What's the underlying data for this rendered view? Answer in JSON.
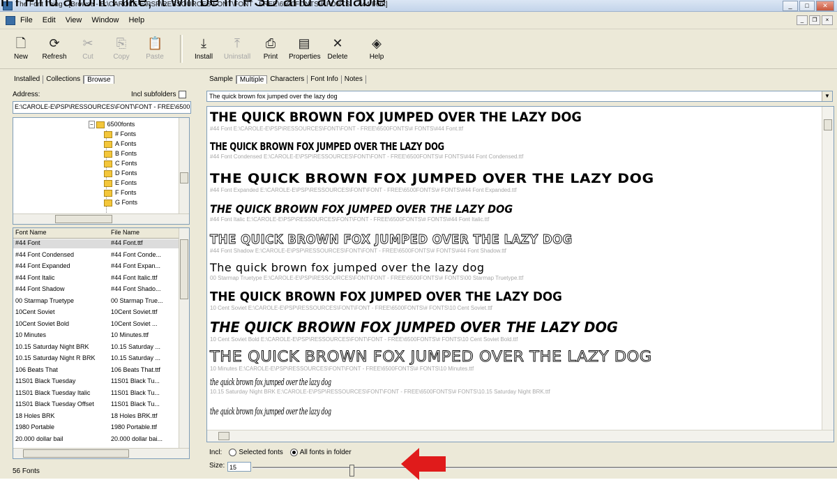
{
  "overlay_text": "If I Find a font I like, it will be in PSD and available",
  "window": {
    "title": "The Font Thing - [Browse - E:\\CAROLE-E\\PSP\\RESSOURCES\\FONT\\FONT - FREE\\6500FONTS\\# FONTS\\ - #44 Font]"
  },
  "menu": [
    "File",
    "Edit",
    "View",
    "Window",
    "Help"
  ],
  "toolbar": {
    "new": "New",
    "refresh": "Refresh",
    "cut": "Cut",
    "copy": "Copy",
    "paste": "Paste",
    "install": "Install",
    "uninstall": "Uninstall",
    "print": "Print",
    "properties": "Properties",
    "delete": "Delete",
    "help": "Help"
  },
  "left": {
    "tabs": [
      "Installed",
      "Collections",
      "Browse"
    ],
    "address_label": "Address:",
    "incl_subfolders": "Incl subfolders",
    "address_value": "E:\\CAROLE-E\\PSP\\RESSOURCES\\FONT\\FONT - FREE\\6500FONTS\\# FONTS",
    "tree": [
      "6500fonts",
      "# Fonts",
      "A Fonts",
      "B Fonts",
      "C Fonts",
      "D Fonts",
      "E Fonts",
      "F Fonts",
      "G Fonts"
    ],
    "columns": [
      "Font Name",
      "File Name"
    ],
    "fonts": [
      [
        "#44 Font",
        "#44 Font.ttf"
      ],
      [
        "#44 Font Condensed",
        "#44 Font Conde..."
      ],
      [
        "#44 Font Expanded",
        "#44 Font Expan..."
      ],
      [
        "#44 Font Italic",
        "#44 Font Italic.ttf"
      ],
      [
        "#44 Font Shadow",
        "#44 Font Shado..."
      ],
      [
        "00 Starmap Truetype",
        "00 Starmap True..."
      ],
      [
        "10Cent Soviet",
        "10Cent Soviet.ttf"
      ],
      [
        "10Cent Soviet Bold",
        "10Cent Soviet ..."
      ],
      [
        "10 Minutes",
        "10 Minutes.ttf"
      ],
      [
        "10.15 Saturday Night BRK",
        "10.15 Saturday ..."
      ],
      [
        "10.15 Saturday Night R BRK",
        "10.15 Saturday ..."
      ],
      [
        "106 Beats That",
        "106 Beats That.ttf"
      ],
      [
        "11S01 Black Tuesday",
        "11S01 Black Tu..."
      ],
      [
        "11S01 Black Tuesday Italic",
        "11S01 Black Tu..."
      ],
      [
        "11S01 Black Tuesday Offset",
        "11S01 Black Tu..."
      ],
      [
        "18 Holes BRK",
        "18 Holes BRK.ttf"
      ],
      [
        "1980 Portable",
        "1980 Portable.ttf"
      ],
      [
        "20.000 dollar bail",
        "20.000 dollar bai..."
      ]
    ],
    "status": "56 Fonts"
  },
  "right": {
    "tabs": [
      "Sample",
      "Multiple",
      "Characters",
      "Font Info",
      "Notes"
    ],
    "sample_text": "The quick brown fox jumped over the lazy dog",
    "previews": [
      {
        "sample": "THE QUICK BROWN FOX JUMPED OVER THE LAZY DOG",
        "path": "#44 Font     E:\\CAROLE-E\\PSP\\RESSOURCES\\FONT\\FONT - FREE\\6500FONTS\\# FONTS\\#44 Font.ttf"
      },
      {
        "sample": "THE QUICK BROWN FOX JUMPED OVER THE LAZY DOG",
        "path": "#44 Font Condensed     E:\\CAROLE-E\\PSP\\RESSOURCES\\FONT\\FONT - FREE\\6500FONTS\\# FONTS\\#44 Font Condensed.ttf"
      },
      {
        "sample": "THE QUICK BROWN FOX JUMPED OVER THE LAZY DOG",
        "path": "#44 Font Expanded     E:\\CAROLE-E\\PSP\\RESSOURCES\\FONT\\FONT - FREE\\6500FONTS\\# FONTS\\#44 Font Expanded.ttf"
      },
      {
        "sample": "THE QUICK BROWN FOX JUMPED OVER THE LAZY DOG",
        "path": "#44 Font Italic     E:\\CAROLE-E\\PSP\\RESSOURCES\\FONT\\FONT - FREE\\6500FONTS\\# FONTS\\#44 Font Italic.ttf"
      },
      {
        "sample": "THE QUICK BROWN FOX JUMPED OVER THE LAZY DOG",
        "path": "#44 Font Shadow     E:\\CAROLE-E\\PSP\\RESSOURCES\\FONT\\FONT - FREE\\6500FONTS\\# FONTS\\#44 Font Shadow.ttf"
      },
      {
        "sample": "The quick brown fox jumped over the lazy dog",
        "path": "00 Starmap Truetype     E:\\CAROLE-E\\PSP\\RESSOURCES\\FONT\\FONT - FREE\\6500FONTS\\# FONTS\\00 Starmap Truetype.ttf"
      },
      {
        "sample": "THE QUICK BROWN FOX JUMPED OVER THE LAZY DOG",
        "path": "10 Cent Soviet     E:\\CAROLE-E\\PSP\\RESSOURCES\\FONT\\FONT - FREE\\6500FONTS\\# FONTS\\10 Cent Soviet.ttf"
      },
      {
        "sample": "THE QUICK BROWN FOX JUMPED OVER THE LAZY DOG",
        "path": "10 Cent Soviet Bold     E:\\CAROLE-E\\PSP\\RESSOURCES\\FONT\\FONT - FREE\\6500FONTS\\# FONTS\\10 Cent Soviet Bold.ttf"
      },
      {
        "sample": "THE QUICK BROWN FOX JUMPED OVER THE LAZY DOG",
        "path": "10 Minutes     E:\\CAROLE-E\\PSP\\RESSOURCES\\FONT\\FONT - FREE\\6500FONTS\\# FONTS\\10 Minutes.ttf"
      },
      {
        "sample": "the quick brown fox jumped over the lazy dog",
        "path": "10.15 Saturday Night BRK     E:\\CAROLE-E\\PSP\\RESSOURCES\\FONT\\FONT - FREE\\6500FONTS\\# FONTS\\10.15 Saturday Night BRK.ttf"
      },
      {
        "sample": "the quick brown fox jumped over the lazy dog",
        "path": ""
      }
    ],
    "incl_label": "Incl:",
    "selected_fonts": "Selected fonts",
    "all_fonts": "All fonts in folder",
    "size_label": "Size:",
    "size_value": "15"
  },
  "colors": {
    "arrow": "#e01b1b",
    "window_bg": "#ece9d8"
  }
}
